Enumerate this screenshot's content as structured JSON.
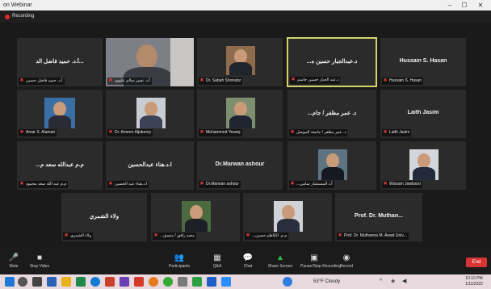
{
  "window": {
    "title": "on Webinar",
    "controls": [
      "–",
      "☐",
      "✕"
    ]
  },
  "recording": {
    "label": "Recording"
  },
  "tiles": [
    {
      "label": "أ.د. حميد فاضل حسين",
      "center": "أ.د. حميد فاضل الد..."
    },
    {
      "label": "أ.د. نصير سالم عليوي",
      "center": ""
    },
    {
      "label": "Dr. Sabah Shonabz",
      "center": ""
    },
    {
      "label": "د.عبد الجبار حسين جاسم",
      "center": "...د.عبدالجبار حسين ه"
    },
    {
      "label": "Hussain S. Hasan",
      "center": "Hussain S. Hasan"
    },
    {
      "label": "Amar S. Alamari",
      "center": ""
    },
    {
      "label": "Dr. Ameen Aljuboory",
      "center": ""
    },
    {
      "label": "Mohammed Yeseej",
      "center": ""
    },
    {
      "label": "د. عمر مظفر / جامعة الموصل",
      "center": "...د. عمر مظفر / جام"
    },
    {
      "label": "Laith Jasim",
      "center": "Laith Jasim"
    },
    {
      "label": "م.م عبد الله سعد محمود",
      "center": "...م.م عبدالله سعد م"
    },
    {
      "label": "ا.د.هناء عبد الحسين",
      "center": "ا.د.هناء عبدالحسين"
    },
    {
      "label": "Dr.Marwan ashour",
      "center": "Dr.Marwan ashour"
    },
    {
      "label": "...أ.د المستشار سامي",
      "center": ""
    },
    {
      "label": "Wissam Jawbarsi",
      "center": ""
    },
    {
      "label": "ولاء الشمري",
      "center": "ولاء الشمري"
    },
    {
      "label": "...مجيد رافق / منسق",
      "center": ""
    },
    {
      "label": "...م.م. الكاظم حسين",
      "center": ""
    },
    {
      "label": "Prof. Dr. Muthanna M. Awad Univ...",
      "center": "Prof. Dr. Muthan..."
    }
  ],
  "toolbar": {
    "buttons": [
      {
        "icon": "🎤",
        "label": "Mute"
      },
      {
        "icon": "■",
        "label": "Stop Video"
      },
      {
        "icon": "👥",
        "label": "Participants"
      },
      {
        "icon": "▦",
        "label": "Q&A"
      },
      {
        "icon": "💬",
        "label": "Chat"
      },
      {
        "icon": "▲",
        "label": "Share Screen"
      },
      {
        "icon": "▣",
        "label": "Pause/Stop Recording"
      },
      {
        "icon": "◉",
        "label": "Record"
      }
    ],
    "end": "End"
  },
  "taskbar": {
    "weather": "53°F Cloudy",
    "time": "10:10 PM",
    "date": "1/11/2022"
  },
  "colors": {
    "speaking_border": "#d4d46a",
    "end_button": "#d93434",
    "mute_icon": "#e23a3a"
  }
}
